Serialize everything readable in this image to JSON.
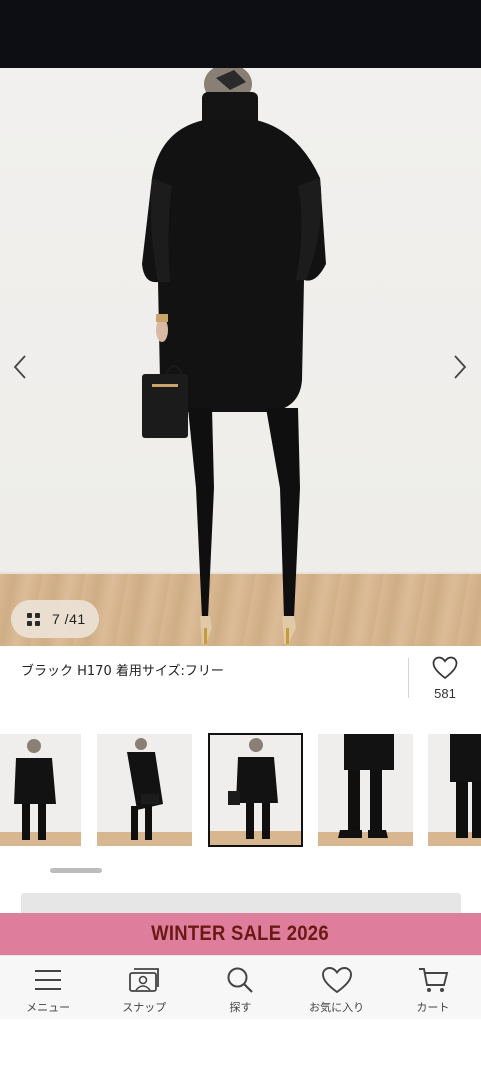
{
  "gallery": {
    "current": "7",
    "total": "41",
    "counter_text": "7 /41",
    "prev_icon": "chevron-left-icon",
    "next_icon": "chevron-right-icon",
    "grid_icon": "grid-icon"
  },
  "product": {
    "caption": "ブラック H170 着用サイズ:フリー",
    "like_count": "581",
    "like_icon": "heart-outline-icon"
  },
  "thumbnails": {
    "count_visible": 5,
    "active_index": 2
  },
  "banner": {
    "text": "WINTER SALE 2026",
    "background": "#df7e9c",
    "text_color": "#6a1a14"
  },
  "nav": {
    "items": [
      {
        "label": "メニュー",
        "icon": "menu-icon"
      },
      {
        "label": "スナップ",
        "icon": "snap-photo-icon"
      },
      {
        "label": "探す",
        "icon": "search-icon"
      },
      {
        "label": "お気に入り",
        "icon": "heart-icon"
      },
      {
        "label": "カート",
        "icon": "cart-icon"
      }
    ]
  },
  "colors": {
    "topbar": "#0d0d14",
    "accent_pink": "#df7e9c"
  }
}
